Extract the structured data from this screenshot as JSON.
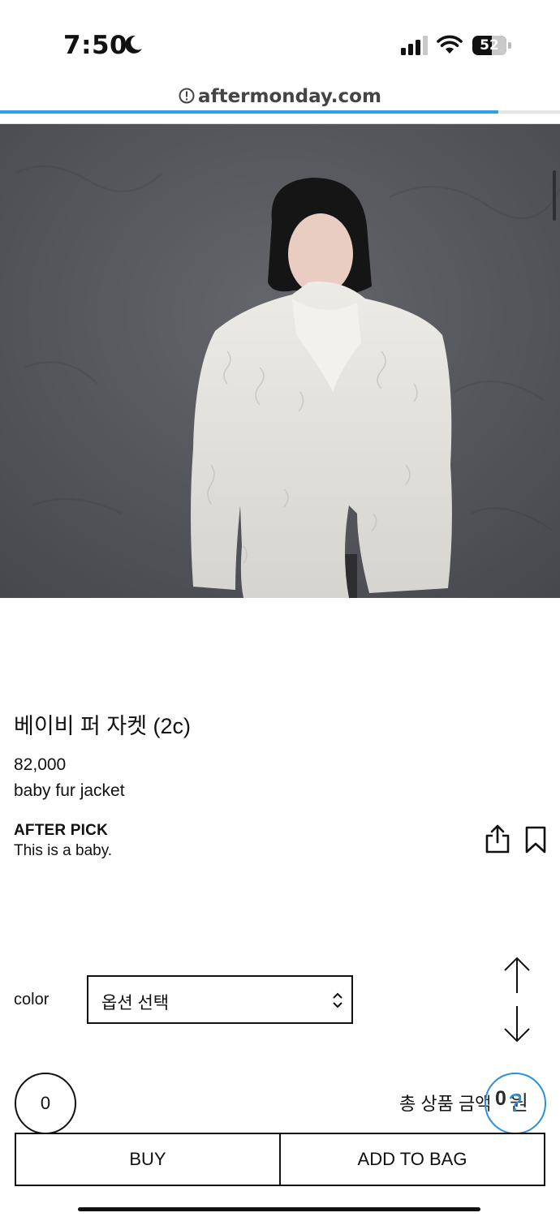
{
  "status_bar": {
    "time": "7:50",
    "battery_level": "52",
    "battery_fill_percent": 52
  },
  "browser": {
    "url": "aftermonday.com",
    "load_progress": 0.89,
    "accent_color": "#2ba2e6"
  },
  "product": {
    "title": "베이비 퍼 자켓 (2c)",
    "price": "82,000",
    "english_name": "baby fur jacket",
    "pick_heading": "AFTER PICK",
    "pick_text": "This is a baby."
  },
  "options": {
    "label": "color",
    "selected": "옵션 선택"
  },
  "order": {
    "quantity": "0",
    "total_label": "총 상품 금액",
    "total_value": "0",
    "total_unit": "원",
    "help_glyph": "?"
  },
  "actions": {
    "buy": "BUY",
    "add_to_bag": "ADD TO BAG"
  },
  "icons": {
    "share": "share-icon",
    "bookmark": "bookmark-icon",
    "scroll_up": "arrow-up-icon",
    "scroll_down": "arrow-down-icon"
  }
}
